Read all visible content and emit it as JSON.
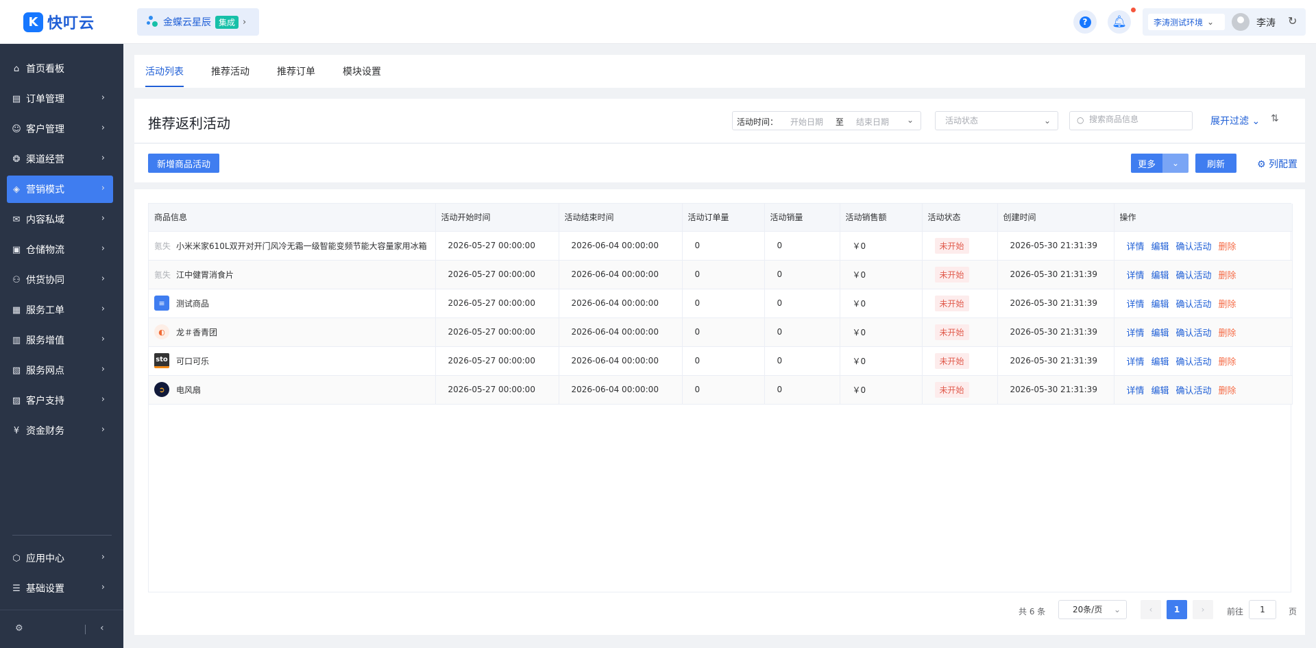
{
  "brand": {
    "logo_glyph": "K",
    "name": "快叮云",
    "color": "#1677ff"
  },
  "header": {
    "switch_label": "金蝶云星辰",
    "switch_badge": "集成",
    "help_glyph": "?",
    "env_label": "李涛测试环境",
    "user_name": "李涛"
  },
  "sidebar": {
    "items": [
      {
        "label": "首页看板",
        "icon": "home-icon",
        "glyph": "⌂"
      },
      {
        "label": "订单管理",
        "icon": "order-icon",
        "glyph": "▤"
      },
      {
        "label": "客户管理",
        "icon": "user-icon",
        "glyph": "☺"
      },
      {
        "label": "渠道经营",
        "icon": "channel-icon",
        "glyph": "❂"
      },
      {
        "label": "营销模式",
        "icon": "tag-icon",
        "glyph": "◈",
        "active": true
      },
      {
        "label": "内容私域",
        "icon": "mail-icon",
        "glyph": "✉"
      },
      {
        "label": "仓储物流",
        "icon": "warehouse-icon",
        "glyph": "▣"
      },
      {
        "label": "供货协同",
        "icon": "supply-icon",
        "glyph": "⚇"
      },
      {
        "label": "服务工单",
        "icon": "ticket-icon",
        "glyph": "▦"
      },
      {
        "label": "服务增值",
        "icon": "gift-icon",
        "glyph": "▥"
      },
      {
        "label": "服务网点",
        "icon": "store-icon",
        "glyph": "▧"
      },
      {
        "label": "客户支持",
        "icon": "support-icon",
        "glyph": "▨"
      },
      {
        "label": "资金财务",
        "icon": "yuan-icon",
        "glyph": "¥"
      }
    ],
    "bottom_items": [
      {
        "label": "应用中心",
        "icon": "app-center-icon",
        "glyph": "⬡"
      },
      {
        "label": "基础设置",
        "icon": "settings-list-icon",
        "glyph": "☰"
      }
    ]
  },
  "tabs": [
    {
      "label": "活动列表",
      "active": true
    },
    {
      "label": "推荐活动"
    },
    {
      "label": "推荐订单"
    },
    {
      "label": "模块设置"
    }
  ],
  "page": {
    "title": "推荐返利活动",
    "filters": {
      "time_label": "活动时间：",
      "start_placeholder": "开始日期",
      "to": "至",
      "end_placeholder": "结束日期",
      "status_placeholder": "活动状态",
      "search_placeholder": "搜索商品信息",
      "expand_label": "展开过滤"
    },
    "actions": {
      "add_label": "新增商品活动",
      "more_label": "更多",
      "refresh_label": "刷新",
      "column_config_label": "列配置"
    }
  },
  "table": {
    "columns": [
      "商品信息",
      "活动开始时间",
      "活动结束时间",
      "活动订单量",
      "活动销量",
      "活动销售额",
      "活动状态",
      "创建时间",
      "操作"
    ],
    "rows": [
      {
        "thumb": "lost",
        "thumb_text": "氪失",
        "name": "小米米家610L双开对开门风冷无霜一级智能变频节能大容量家用冰箱",
        "start": "2026-05-27 00:00:00",
        "end": "2026-06-04 00:00:00",
        "orders": "0",
        "sales": "0",
        "amount": "￥0",
        "status": "未开始",
        "created": "2026-05-30 21:31:39"
      },
      {
        "thumb": "lost",
        "thumb_text": "氪失",
        "name": "江中健胃消食片",
        "start": "2026-05-27 00:00:00",
        "end": "2026-06-04 00:00:00",
        "orders": "0",
        "sales": "0",
        "amount": "￥0",
        "status": "未开始",
        "created": "2026-05-30 21:31:39"
      },
      {
        "thumb": "doc",
        "thumb_text": "≡",
        "name": "测试商品",
        "start": "2026-05-27 00:00:00",
        "end": "2026-06-04 00:00:00",
        "orders": "0",
        "sales": "0",
        "amount": "￥0",
        "status": "未开始",
        "created": "2026-05-30 21:31:39"
      },
      {
        "thumb": "lobster",
        "thumb_text": "◐",
        "name": "龙＃香青团",
        "start": "2026-05-27 00:00:00",
        "end": "2026-06-04 00:00:00",
        "orders": "0",
        "sales": "0",
        "amount": "￥0",
        "status": "未开始",
        "created": "2026-05-30 21:31:39"
      },
      {
        "thumb": "sto",
        "thumb_text": "sto",
        "name": "可口可乐",
        "start": "2026-05-27 00:00:00",
        "end": "2026-06-04 00:00:00",
        "orders": "0",
        "sales": "0",
        "amount": "￥0",
        "status": "未开始",
        "created": "2026-05-30 21:31:39"
      },
      {
        "thumb": "fan",
        "thumb_text": "➲",
        "name": "电风扇",
        "start": "2026-05-27 00:00:00",
        "end": "2026-06-04 00:00:00",
        "orders": "0",
        "sales": "0",
        "amount": "￥0",
        "status": "未开始",
        "created": "2026-05-30 21:31:39"
      }
    ],
    "row_actions": {
      "detail": "详情",
      "edit": "编辑",
      "confirm": "确认活动",
      "delete": "删除"
    }
  },
  "pagination": {
    "total": "共 6 条",
    "page_size": "20条/页",
    "current_page": "1",
    "goto_label": "前往",
    "goto_value": "1",
    "page_suffix": "页"
  }
}
